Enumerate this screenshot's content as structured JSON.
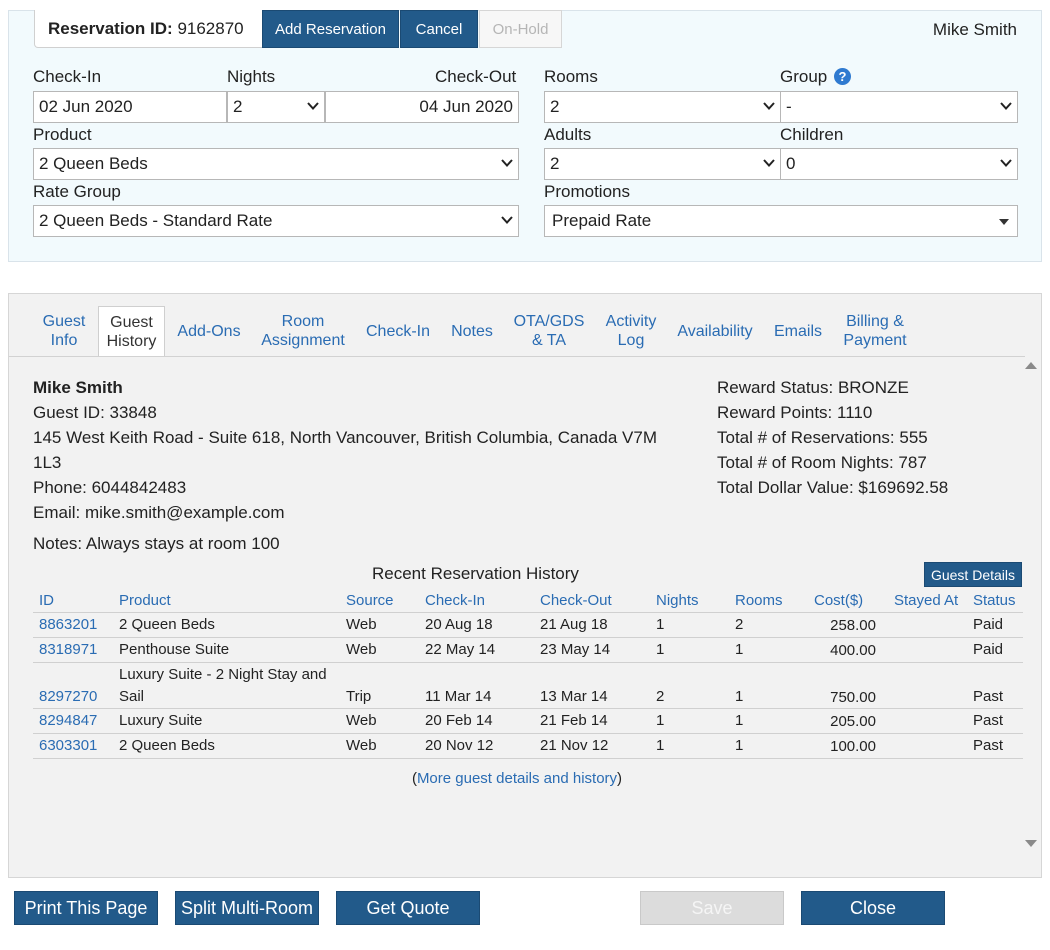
{
  "header": {
    "reservation_id_label": "Reservation ID:",
    "reservation_id": "9162870",
    "add_reservation": "Add Reservation",
    "cancel": "Cancel",
    "on_hold": "On-Hold",
    "user_name": "Mike Smith"
  },
  "form": {
    "checkin_label": "Check-In",
    "checkin_value": "02 Jun 2020",
    "nights_label": "Nights",
    "nights_value": "2",
    "checkout_label": "Check-Out",
    "checkout_value": "04 Jun 2020",
    "rooms_label": "Rooms",
    "rooms_value": "2",
    "group_label": "Group",
    "group_help": "?",
    "group_value": "-",
    "product_label": "Product",
    "product_value": "2 Queen Beds",
    "adults_label": "Adults",
    "adults_value": "2",
    "children_label": "Children",
    "children_value": "0",
    "rate_group_label": "Rate Group",
    "rate_group_value": "2 Queen Beds - Standard Rate",
    "promotions_label": "Promotions",
    "promotions_value": "Prepaid Rate"
  },
  "tabs": [
    {
      "line1": "Guest",
      "line2": "Info"
    },
    {
      "line1": "Guest",
      "line2": "History"
    },
    {
      "line1": "Add-Ons",
      "line2": ""
    },
    {
      "line1": "Room",
      "line2": "Assignment"
    },
    {
      "line1": "Check-In",
      "line2": ""
    },
    {
      "line1": "Notes",
      "line2": ""
    },
    {
      "line1": "OTA/GDS",
      "line2": "& TA"
    },
    {
      "line1": "Activity",
      "line2": "Log"
    },
    {
      "line1": "Availability",
      "line2": ""
    },
    {
      "line1": "Emails",
      "line2": ""
    },
    {
      "line1": "Billing &",
      "line2": "Payment"
    }
  ],
  "guest": {
    "name": "Mike Smith",
    "guest_id": "Guest ID: 33848",
    "address_line1": "145 West Keith Road - Suite 618, North Vancouver, British Columbia, Canada V7M",
    "address_line2": "1L3",
    "phone": "Phone: 6044842483",
    "email": "Email: mike.smith@example.com",
    "notes": "Notes: Always stays at room 100",
    "reward_status": "Reward Status: BRONZE",
    "reward_points": "Reward Points: 1110",
    "total_reservations": "Total # of Reservations: 555",
    "total_room_nights": "Total # of Room Nights: 787",
    "total_dollar_value": "Total Dollar Value: $169692.58"
  },
  "history": {
    "title": "Recent Reservation History",
    "guest_details_button": "Guest Details",
    "columns": [
      "ID",
      "Product",
      "Source",
      "Check-In",
      "Check-Out",
      "Nights",
      "Rooms",
      "Cost($)",
      "Stayed At",
      "Status"
    ],
    "rows": [
      {
        "id": "8863201",
        "product": "2 Queen Beds",
        "product2": "",
        "source": "Web",
        "checkin": "20 Aug 18",
        "checkout": "21 Aug 18",
        "nights": "1",
        "rooms": "2",
        "cost": "258.00",
        "stayed_at": "",
        "status": "Paid"
      },
      {
        "id": "8318971",
        "product": "Penthouse Suite",
        "product2": "",
        "source": "Web",
        "checkin": "22 May 14",
        "checkout": "23 May 14",
        "nights": "1",
        "rooms": "1",
        "cost": "400.00",
        "stayed_at": "",
        "status": "Paid"
      },
      {
        "id": "8297270",
        "product": "Luxury Suite - 2 Night Stay and",
        "product2": "Sail",
        "source": "Trip",
        "checkin": "11 Mar 14",
        "checkout": "13 Mar 14",
        "nights": "2",
        "rooms": "1",
        "cost": "750.00",
        "stayed_at": "",
        "status": "Past"
      },
      {
        "id": "8294847",
        "product": "Luxury Suite",
        "product2": "",
        "source": "Web",
        "checkin": "20 Feb 14",
        "checkout": "21 Feb 14",
        "nights": "1",
        "rooms": "1",
        "cost": "205.00",
        "stayed_at": "",
        "status": "Past"
      },
      {
        "id": "6303301",
        "product": "2 Queen Beds",
        "product2": "",
        "source": "Web",
        "checkin": "20 Nov 12",
        "checkout": "21 Nov 12",
        "nights": "1",
        "rooms": "1",
        "cost": "100.00",
        "stayed_at": "",
        "status": "Past"
      }
    ],
    "more_open": "(",
    "more_link": "More guest details and history",
    "more_close": ")"
  },
  "footer": {
    "print": "Print This Page",
    "split": "Split Multi-Room",
    "quote": "Get Quote",
    "save": "Save",
    "close": "Close"
  },
  "colors": {
    "primary_button": "#225a8a",
    "link": "#2a6cb3",
    "top_panel_bg": "#f2fafd",
    "main_panel_bg": "#f2f2f2"
  }
}
